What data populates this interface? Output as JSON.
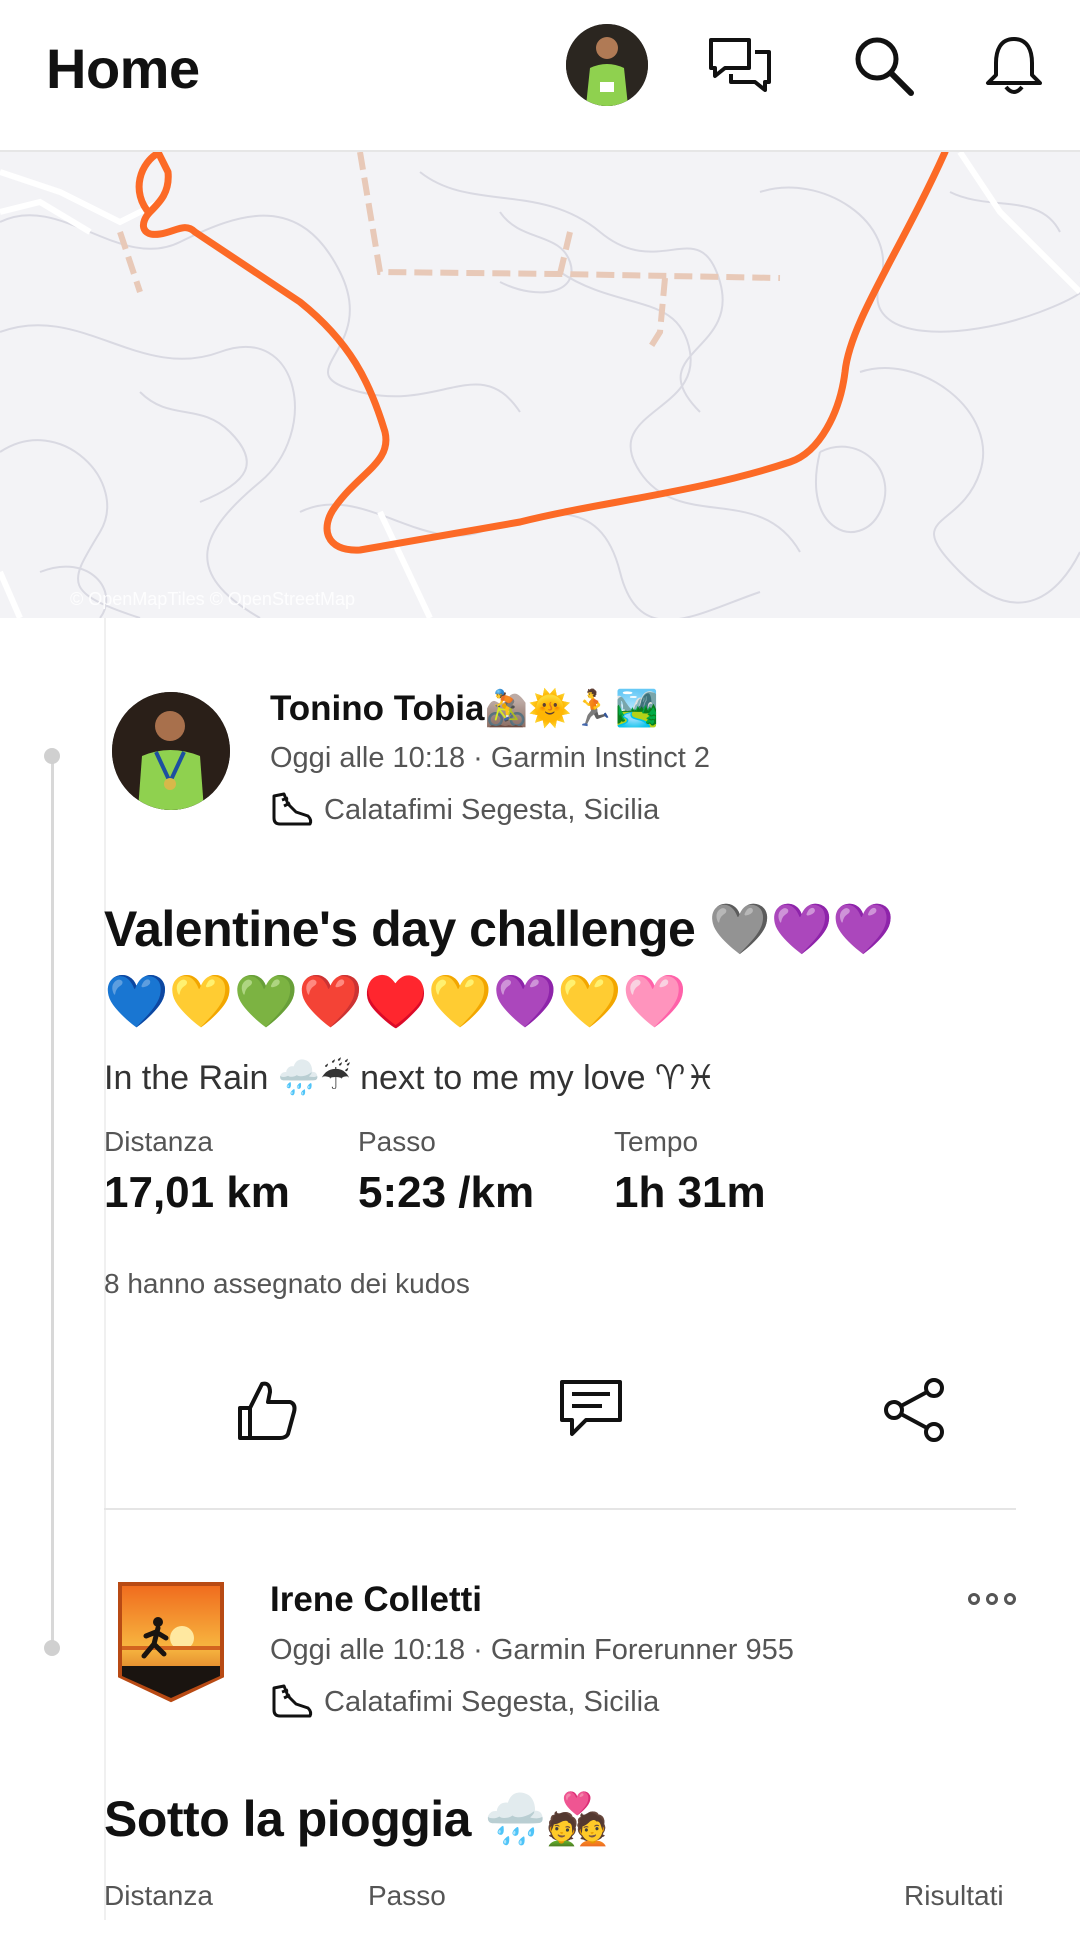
{
  "header": {
    "title": "Home",
    "icons": [
      "avatar",
      "chat-icon",
      "search-icon",
      "bell-icon"
    ]
  },
  "map": {
    "credit": "© OpenMapTiles © OpenStreetMap",
    "route_color": "#fc6a26"
  },
  "activities": [
    {
      "athlete": "Tonino Tobia🚵🌞🏃🏞️",
      "meta": "Oggi alle 10:18 · Garmin Instinct 2",
      "location": "Calatafimi Segesta, Sicilia",
      "title": "Valentine's day challenge 🩶💜💜",
      "title_emojis": "💙💛💚❤️♥️💛💜💛🩷",
      "description": "In the Rain 🌧️☔ next to me my love ♈♓",
      "stats": [
        {
          "label": "Distanza",
          "value": "17,01 km"
        },
        {
          "label": "Passo",
          "value": "5:23 /km"
        },
        {
          "label": "Tempo",
          "value": "1h 31m"
        }
      ],
      "kudos": "8 hanno assegnato dei kudos",
      "actions": [
        "kudos-icon",
        "comment-icon",
        "share-icon"
      ]
    },
    {
      "athlete": "Irene Colletti",
      "meta": "Oggi alle 10:18 · Garmin Forerunner 955",
      "location": "Calatafimi Segesta, Sicilia",
      "title": "Sotto la pioggia 🌧️💑",
      "stats_labels": {
        "distance": "Distanza",
        "pace": "Passo",
        "results": "Risultati"
      }
    }
  ]
}
